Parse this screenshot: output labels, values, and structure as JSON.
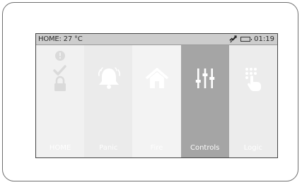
{
  "status": {
    "home_text": "HOME: 27 °C",
    "time": "01:19",
    "icons": [
      "signal-off-icon",
      "battery-icon"
    ]
  },
  "tiles": [
    {
      "label": "HOME",
      "icon": "status-stack-icon",
      "selected": false
    },
    {
      "label": "Panic",
      "icon": "bell-alarm-icon",
      "selected": false
    },
    {
      "label": "Fire",
      "icon": "house-icon",
      "selected": false
    },
    {
      "label": "Controls",
      "icon": "sliders-icon",
      "selected": true
    },
    {
      "label": "Logic",
      "icon": "touch-grid-icon",
      "selected": false
    }
  ],
  "colors": {
    "selected_tile": "#a5a5a5",
    "status_bar": "#cdcdcd",
    "tile_text": "#ffffff"
  }
}
